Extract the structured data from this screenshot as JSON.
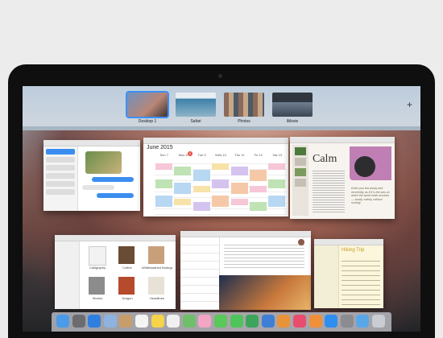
{
  "spaces": [
    {
      "label": "Desktop 1",
      "color": "#5a86b8"
    },
    {
      "label": "Safari",
      "color": "#3b7fa8"
    },
    {
      "label": "Photos",
      "color": "#6e5c52"
    },
    {
      "label": "iMovie",
      "color": "#4a5566"
    }
  ],
  "add_space": "+",
  "calendar": {
    "month": "June 2015",
    "days": [
      "Sun 7",
      "Mon 8",
      "Tue 9",
      "Wed 10",
      "Thu 11",
      "Fri 12",
      "Sat 13"
    ],
    "today_badge": "8"
  },
  "ibooks": {
    "title": "Calm",
    "quote": "Drink your tea slowly and reverently, as if it is the axis on which the world earth revolves — slowly, evenly, without rushing"
  },
  "finder": {
    "items": [
      "Calligraphy",
      "Coffee",
      "Whitewashed Bodegas",
      "Stones",
      "Dragon",
      "Headlines"
    ]
  },
  "notes": {
    "title": "Hiking Trip"
  },
  "dock_icons": [
    "finder",
    "launchpad",
    "safari",
    "mail",
    "contacts",
    "calendar",
    "notes",
    "reminders",
    "maps",
    "photos",
    "messages",
    "facetime",
    "numbers",
    "keynote",
    "pages",
    "itunes",
    "ibooks",
    "app-store",
    "system-preferences",
    "downloads",
    "trash"
  ]
}
